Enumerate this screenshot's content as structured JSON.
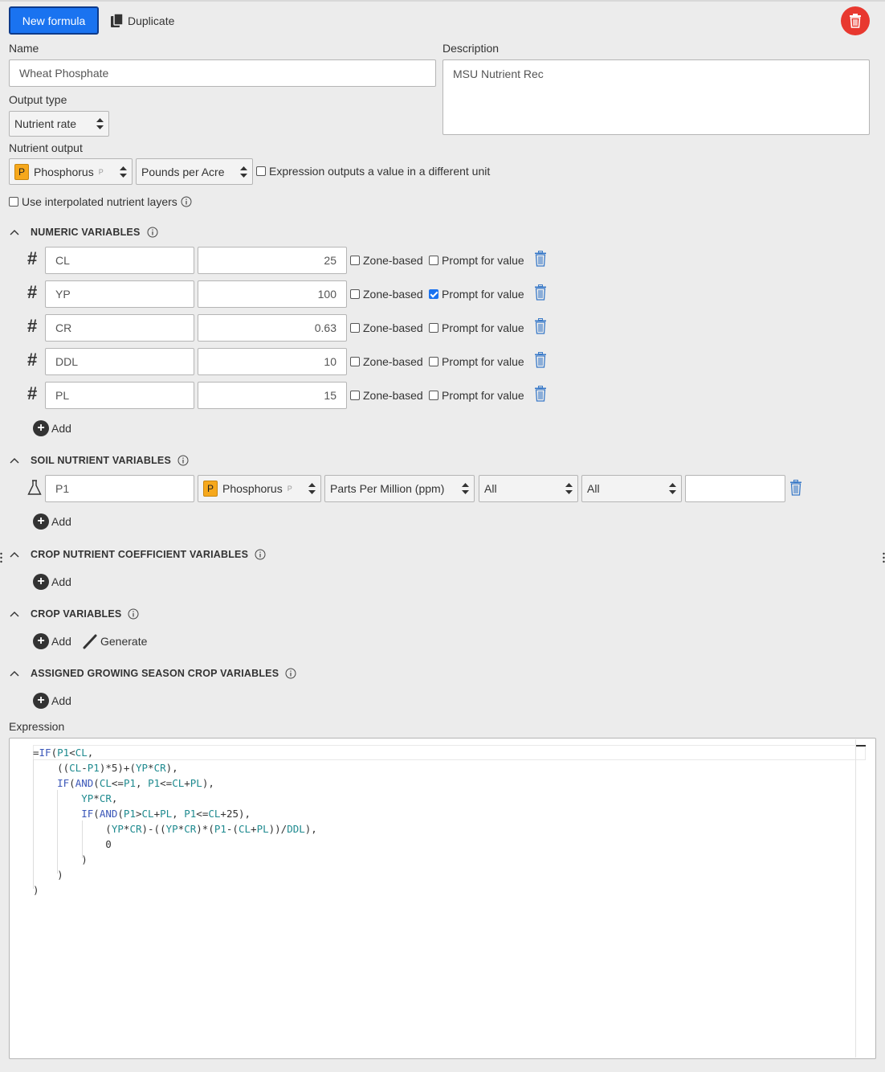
{
  "toolbar": {
    "new_formula_label": "New formula",
    "duplicate_label": "Duplicate"
  },
  "form": {
    "name_label": "Name",
    "name_value": "Wheat Phosphate",
    "description_label": "Description",
    "description_value": "MSU Nutrient Rec",
    "output_type_label": "Output type",
    "output_type_value": "Nutrient rate",
    "nutrient_output_label": "Nutrient output",
    "nutrient_badge": "P",
    "nutrient_value": "Phosphorus",
    "nutrient_sub": "P",
    "unit_value": "Pounds per Acre",
    "different_unit_label": "Expression outputs a value in a different unit",
    "interpolated_label": "Use interpolated nutrient layers"
  },
  "sections": {
    "numeric": "NUMERIC VARIABLES",
    "soil": "SOIL NUTRIENT VARIABLES",
    "crop_coeff": "CROP NUTRIENT COEFFICIENT VARIABLES",
    "crop": "CROP VARIABLES",
    "assigned": "ASSIGNED GROWING SEASON CROP VARIABLES"
  },
  "numeric_vars": [
    {
      "name": "CL",
      "value": "25",
      "zone_based": false,
      "prompt": false
    },
    {
      "name": "YP",
      "value": "100",
      "zone_based": false,
      "prompt": true
    },
    {
      "name": "CR",
      "value": "0.63",
      "zone_based": false,
      "prompt": false
    },
    {
      "name": "DDL",
      "value": "10",
      "zone_based": false,
      "prompt": false
    },
    {
      "name": "PL",
      "value": "15",
      "zone_based": false,
      "prompt": false
    }
  ],
  "labels": {
    "zone_based": "Zone-based",
    "prompt": "Prompt for value",
    "add": "Add",
    "generate": "Generate",
    "expression": "Expression"
  },
  "soil_var": {
    "name": "P1",
    "nutrient_badge": "P",
    "nutrient": "Phosphorus",
    "nutrient_sub": "P",
    "unit": "Parts Per Million (ppm)",
    "filter1": "All",
    "filter2": "All",
    "extra": ""
  },
  "expression_lines": [
    "=IF(P1<CL,",
    "    ((CL-P1)*5)+(YP*CR),",
    "    IF(AND(CL<=P1, P1<=CL+PL),",
    "        YP*CR,",
    "        IF(AND(P1>CL+PL, P1<=CL+25),",
    "            (YP*CR)-((YP*CR)*(P1-(CL+PL))/DDL),",
    "            0",
    "        )",
    "    )",
    ")"
  ],
  "colors": {
    "primary": "#1a73f0",
    "danger": "#e8382f",
    "badge": "#f6a81c",
    "background": "#ececec"
  }
}
